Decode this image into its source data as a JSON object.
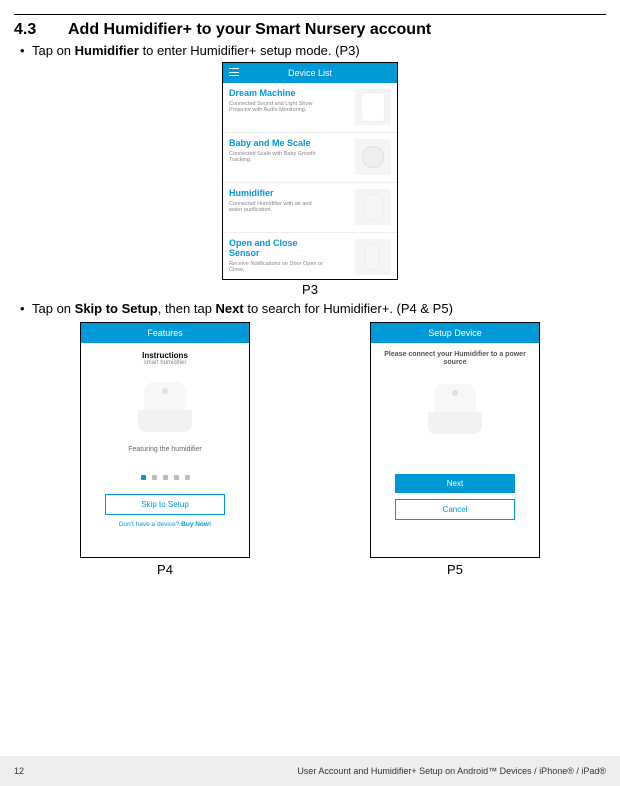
{
  "section": {
    "number": "4.3",
    "title": "Add Humidifier+ to your Smart Nursery account"
  },
  "bullet1": {
    "pre": "Tap on ",
    "b": "Humidifier",
    "post": " to enter Humidifier+ setup mode. (P3)"
  },
  "bullet2": {
    "pre": "Tap on ",
    "b1": "Skip to Setup",
    "mid": ", then tap ",
    "b2": "Next",
    "post": " to search for Humidifier+. (P4 & P5)"
  },
  "p3": {
    "header": "Device List",
    "items": [
      {
        "title": "Dream Machine",
        "desc": "Connected Sound and Light Show Projector with Audio Monitoring."
      },
      {
        "title": "Baby and Me Scale",
        "desc": "Connected Scale with Baby Growth Tracking."
      },
      {
        "title": "Humidifier",
        "desc": "Connected Humidifier with air and water purification."
      },
      {
        "title": "Open and Close Sensor",
        "desc": "Receive Notifications on Door Open or Close."
      }
    ],
    "label": "P3"
  },
  "p4": {
    "header": "Features",
    "instr_title": "Instructions",
    "instr_sub": "smart humidifier",
    "feat_text": "Featuring the humidifier",
    "skip": "Skip to Setup",
    "buy_pre": "Don't have a device? ",
    "buy_b": "Buy Now!",
    "label": "P4"
  },
  "p5": {
    "header": "Setup Device",
    "msg": "Please connect your Humidifier to a power source",
    "next": "Next",
    "cancel": "Cancel",
    "label": "P5"
  },
  "footer": {
    "page": "12",
    "text": "User Account and Humidifier+ Setup on Android™ Devices / iPhone® / iPad®"
  }
}
